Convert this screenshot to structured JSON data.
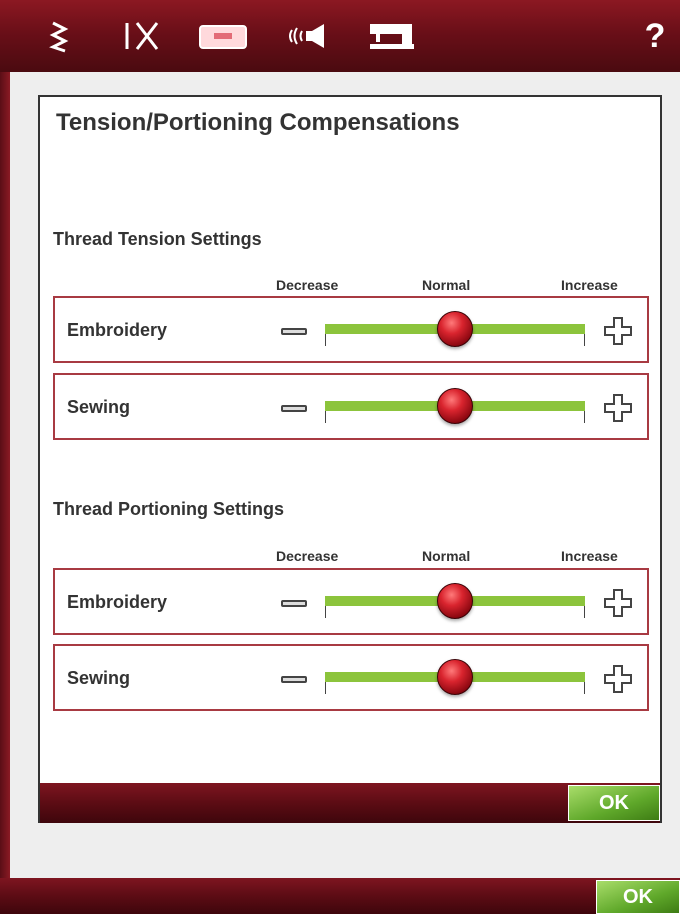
{
  "topbar": {
    "icons": [
      "zigzag-stitch-icon",
      "scissors-icon",
      "embroidery-hoop-icon",
      "sound-icon",
      "sewing-machine-icon"
    ],
    "help_label": "?"
  },
  "dialog": {
    "title": "Tension/Portioning Compensations",
    "sections": [
      {
        "heading": "Thread Tension Settings",
        "scale": {
          "decrease": "Decrease",
          "normal": "Normal",
          "increase": "Increase"
        },
        "rows": [
          {
            "label": "Embroidery",
            "value_fraction": 0.5
          },
          {
            "label": "Sewing",
            "value_fraction": 0.5
          }
        ]
      },
      {
        "heading": "Thread Portioning Settings",
        "scale": {
          "decrease": "Decrease",
          "normal": "Normal",
          "increase": "Increase"
        },
        "rows": [
          {
            "label": "Embroidery",
            "value_fraction": 0.5
          },
          {
            "label": "Sewing",
            "value_fraction": 0.5
          }
        ]
      }
    ],
    "ok_label": "OK"
  },
  "bottom": {
    "ok_label": "OK"
  },
  "colors": {
    "brand_red": "#7e1520",
    "slider_track": "#8cc43c",
    "ok_green": "#5fa82a",
    "row_border": "#a83a42"
  }
}
